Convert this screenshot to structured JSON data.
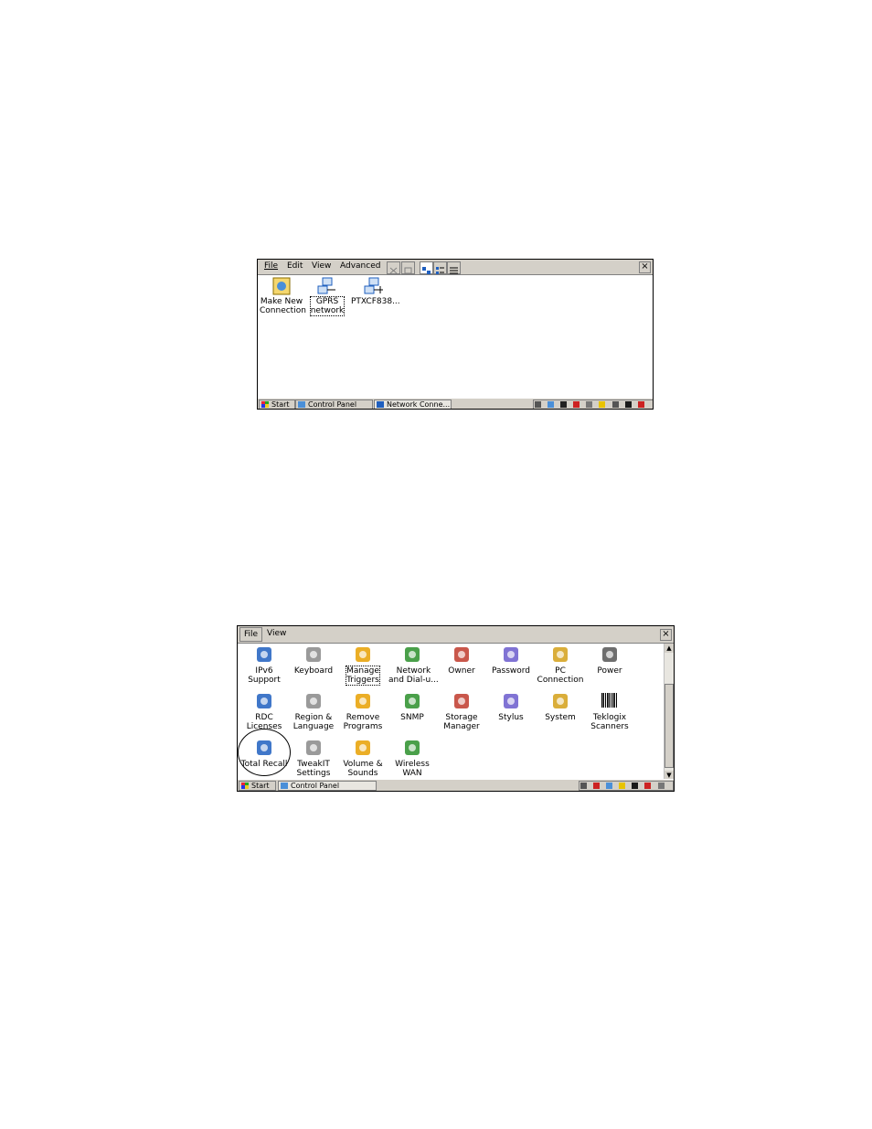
{
  "screen1": {
    "menu": [
      "File",
      "Edit",
      "View",
      "Advanced"
    ],
    "close_label": "×",
    "icons": [
      {
        "label1": "Make New",
        "label2": "Connection",
        "icon": "make-new-connection-icon"
      },
      {
        "label1": "GPRS",
        "label2": "network",
        "icon": "network-connection-icon"
      },
      {
        "label1": "PTXCF838...",
        "label2": "",
        "icon": "network-adapter-icon"
      }
    ],
    "taskbar": {
      "start": "Start",
      "task1": "Control Panel",
      "task2": "Network Conne..."
    }
  },
  "screen2": {
    "menu": [
      "File",
      "View"
    ],
    "close_label": "×",
    "icons": [
      {
        "label1": "IPv6",
        "label2": "Support",
        "icon": "ipv6-icon"
      },
      {
        "label1": "Keyboard",
        "label2": "",
        "icon": "keyboard-icon"
      },
      {
        "label1": "Manage",
        "label2": "Triggers",
        "icon": "triggers-icon"
      },
      {
        "label1": "Network",
        "label2": "and Dial-u...",
        "icon": "network-globe-icon"
      },
      {
        "label1": "Owner",
        "label2": "",
        "icon": "owner-icon"
      },
      {
        "label1": "Password",
        "label2": "",
        "icon": "password-icon"
      },
      {
        "label1": "PC",
        "label2": "Connection",
        "icon": "pc-connection-icon"
      },
      {
        "label1": "Power",
        "label2": "",
        "icon": "power-icon"
      },
      {
        "label1": "RDC",
        "label2": "Licenses",
        "icon": "rdc-icon"
      },
      {
        "label1": "Region &",
        "label2": "Language",
        "icon": "region-globe-icon"
      },
      {
        "label1": "Remove",
        "label2": "Programs",
        "icon": "remove-programs-icon"
      },
      {
        "label1": "SNMP",
        "label2": "",
        "icon": "snmp-icon"
      },
      {
        "label1": "Storage",
        "label2": "Manager",
        "icon": "storage-icon"
      },
      {
        "label1": "Stylus",
        "label2": "",
        "icon": "stylus-icon"
      },
      {
        "label1": "System",
        "label2": "",
        "icon": "system-icon"
      },
      {
        "label1": "Teklogix",
        "label2": "Scanners",
        "icon": "barcode-icon"
      },
      {
        "label1": "Total Recall",
        "label2": "",
        "icon": "total-recall-icon"
      },
      {
        "label1": "TweakIT",
        "label2": "Settings",
        "icon": "tweakit-icon"
      },
      {
        "label1": "Volume &",
        "label2": "Sounds",
        "icon": "volume-icon"
      },
      {
        "label1": "Wireless",
        "label2": "WAN",
        "icon": "wireless-wan-icon"
      }
    ],
    "taskbar": {
      "start": "Start",
      "task1": "Control Panel"
    }
  },
  "colors": {
    "chrome": "#d4d0c8",
    "border": "#808080",
    "accent_blue": "#1f5fbf"
  }
}
